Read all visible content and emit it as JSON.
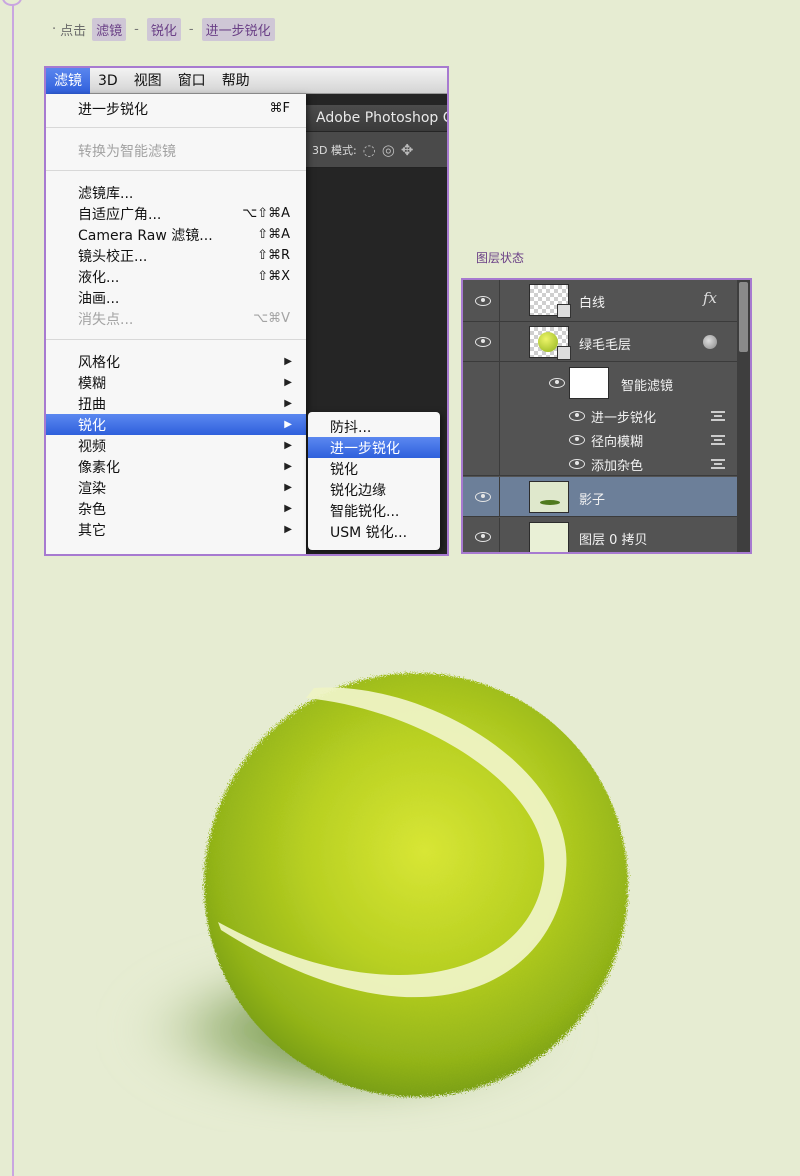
{
  "instruction": {
    "prefix": "点击",
    "bullet": "·",
    "path": [
      "滤镜",
      "锐化",
      "进一步锐化"
    ],
    "separator": "-"
  },
  "menubar": {
    "items": [
      "滤镜",
      "3D",
      "视图",
      "窗口",
      "帮助"
    ],
    "active_index": 0
  },
  "photoshop": {
    "title": "Adobe Photoshop C",
    "options_label": "3D 模式:"
  },
  "filter_menu": {
    "items": [
      {
        "label": "进一步锐化",
        "shortcut": "⌘F"
      },
      {
        "label": "转换为智能滤镜",
        "shortcut": "",
        "disabled": true
      },
      {
        "label": "滤镜库...",
        "shortcut": ""
      },
      {
        "label": "自适应广角...",
        "shortcut": "⌥⇧⌘A"
      },
      {
        "label": "Camera Raw 滤镜...",
        "shortcut": "⇧⌘A"
      },
      {
        "label": "镜头校正...",
        "shortcut": "⇧⌘R"
      },
      {
        "label": "液化...",
        "shortcut": "⇧⌘X"
      },
      {
        "label": "油画...",
        "shortcut": ""
      },
      {
        "label": "消失点...",
        "shortcut": "⌥⌘V",
        "disabled": true
      },
      {
        "label": "风格化",
        "submenu": true
      },
      {
        "label": "模糊",
        "submenu": true
      },
      {
        "label": "扭曲",
        "submenu": true
      },
      {
        "label": "锐化",
        "submenu": true,
        "highlighted": true
      },
      {
        "label": "视频",
        "submenu": true
      },
      {
        "label": "像素化",
        "submenu": true
      },
      {
        "label": "渲染",
        "submenu": true
      },
      {
        "label": "杂色",
        "submenu": true
      },
      {
        "label": "其它",
        "submenu": true
      }
    ],
    "arrow_glyph": "▶"
  },
  "sharpen_submenu": {
    "items": [
      "防抖...",
      "进一步锐化",
      "锐化",
      "锐化边缘",
      "智能锐化...",
      "USM 锐化..."
    ],
    "highlighted_index": 1
  },
  "layers_panel": {
    "caption": "图层状态",
    "layers": [
      {
        "name": "白线",
        "badge": "fx"
      },
      {
        "name": "绿毛毛层"
      },
      {
        "name": "智能滤镜"
      },
      {
        "name": "进一步锐化"
      },
      {
        "name": "径向模糊"
      },
      {
        "name": "添加杂色"
      },
      {
        "name": "影子",
        "selected": true
      },
      {
        "name": "图层 0 拷贝"
      }
    ]
  },
  "colors": {
    "background": "#e6ecd2",
    "accent_purple": "#a77ad0",
    "menu_highlight": "#3f6fe4",
    "ball_green": "#a9c71d",
    "seam": "#eef3c4"
  }
}
